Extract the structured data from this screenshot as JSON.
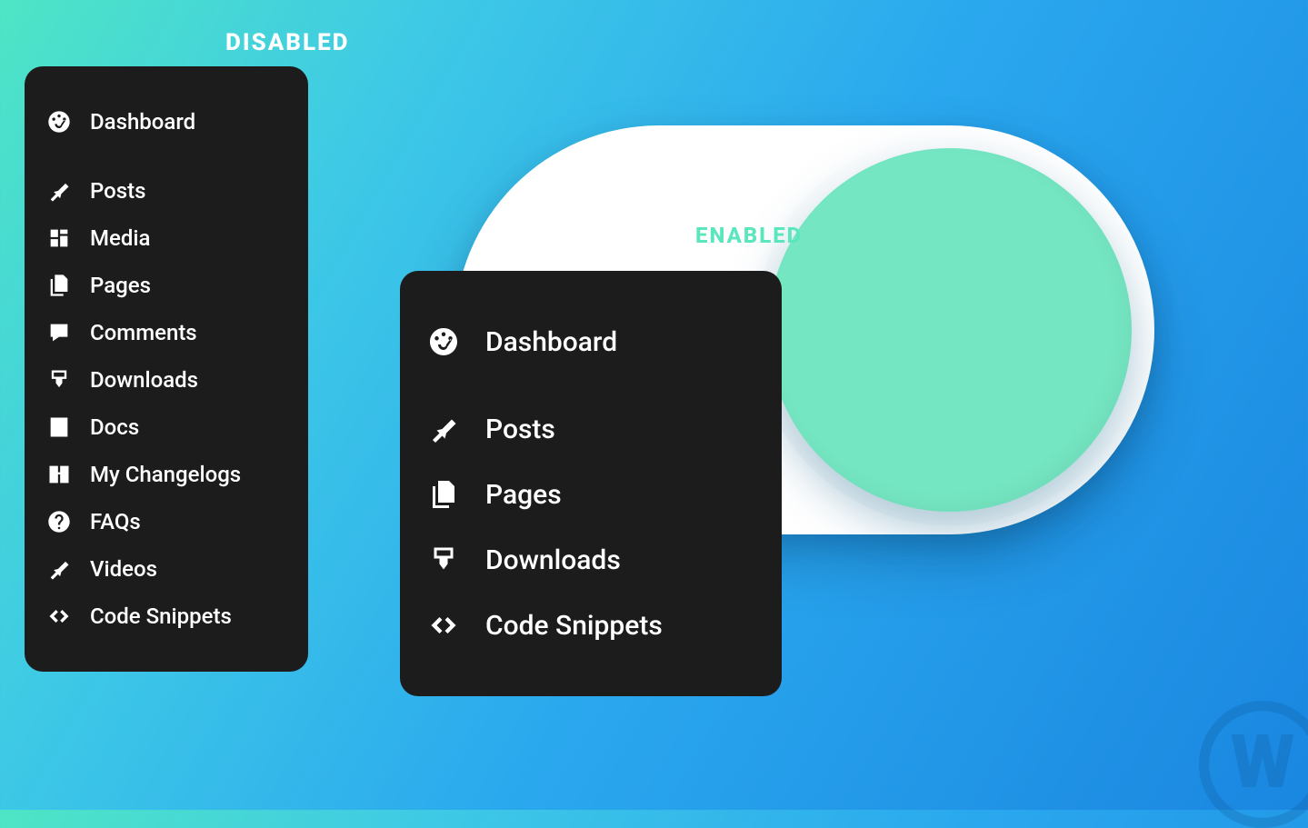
{
  "labels": {
    "disabled": "DISABLED",
    "enabled": "ENABLED"
  },
  "left_menu": {
    "dashboard": "Dashboard",
    "posts": "Posts",
    "media": "Media",
    "pages": "Pages",
    "comments": "Comments",
    "downloads": "Downloads",
    "docs": "Docs",
    "changelogs": "My Changelogs",
    "faqs": "FAQs",
    "videos": "Videos",
    "snippets": "Code Snippets"
  },
  "right_menu": {
    "dashboard": "Dashboard",
    "posts": "Posts",
    "pages": "Pages",
    "downloads": "Downloads",
    "snippets": "Code Snippets"
  },
  "toggle": {
    "state": "enabled",
    "colors": {
      "track": "#ffffff",
      "knob": "#75e6c2",
      "enabled_text": "#5be6bd"
    }
  },
  "watermark": "W"
}
